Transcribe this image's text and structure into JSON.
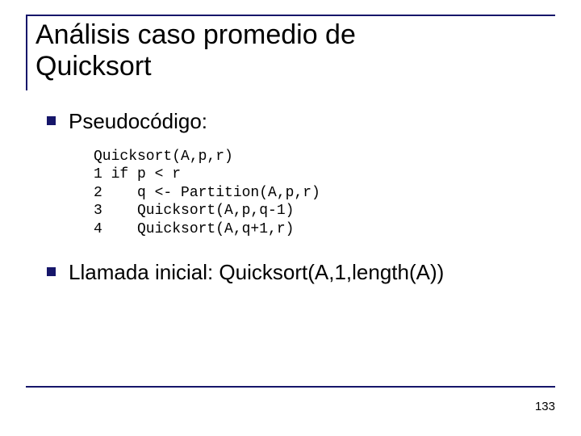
{
  "title_line1": "Análisis caso promedio de",
  "title_line2": "Quicksort",
  "bullets": {
    "b0": "Pseudocódigo:",
    "b1": "Llamada inicial: Quicksort(A,1,length(A))"
  },
  "code": {
    "l0": "Quicksort(A,p,r)",
    "l1": "1 if p < r",
    "l2": "2    q <- Partition(A,p,r)",
    "l3": "3    Quicksort(A,p,q-1)",
    "l4": "4    Quicksort(A,q+1,r)"
  },
  "page_number": "133"
}
